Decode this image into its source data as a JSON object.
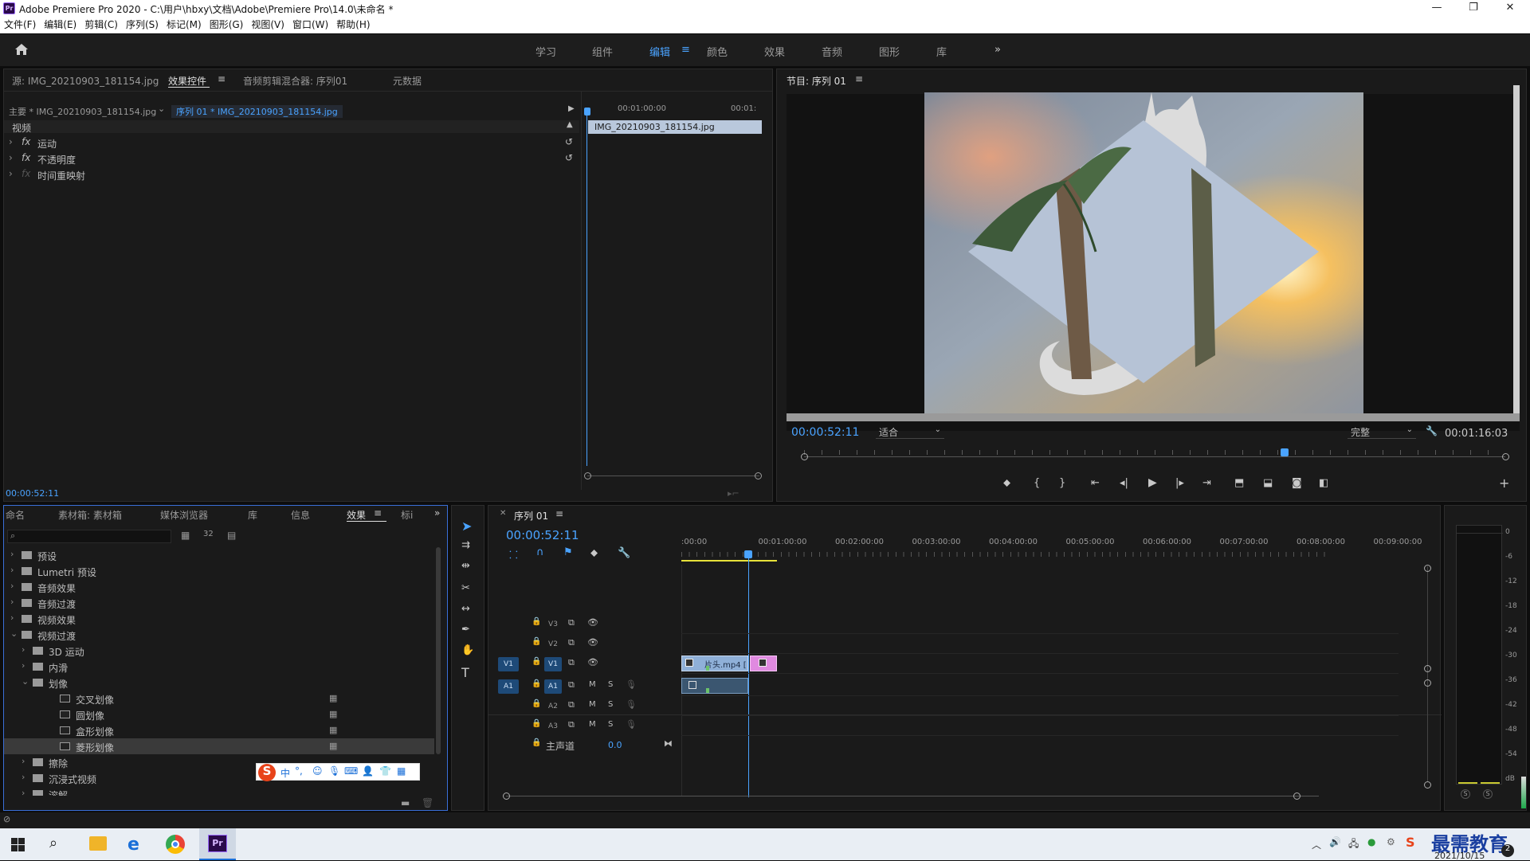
{
  "window": {
    "title": "Adobe Premiere Pro 2020 - C:\\用户\\hbxy\\文档\\Adobe\\Premiere Pro\\14.0\\未命名 *",
    "logo": "Pr",
    "controls": [
      "minimize-icon",
      "restore-icon",
      "close-icon"
    ]
  },
  "menu": [
    "文件(F)",
    "编辑(E)",
    "剪辑(C)",
    "序列(S)",
    "标记(M)",
    "图形(G)",
    "视图(V)",
    "窗口(W)",
    "帮助(H)"
  ],
  "workspaces": [
    "学习",
    "组件",
    "编辑",
    "颜色",
    "效果",
    "音频",
    "图形",
    "库"
  ],
  "active_workspace": "编辑",
  "effect_controls": {
    "tabs": [
      "源: IMG_20210903_181154.jpg",
      "效果控件",
      "音频剪辑混合器: 序列01",
      "元数据"
    ],
    "active_tab": "效果控件",
    "master": "主要 * IMG_20210903_181154.jpg",
    "sequence_clip": "序列 01 * IMG_20210903_181154.jpg",
    "ruler": [
      "00:01:00:00",
      "00:01:"
    ],
    "clip_name": "IMG_20210903_181154.jpg",
    "section": "视频",
    "effects": [
      {
        "fx": "fx",
        "name": "运动"
      },
      {
        "fx": "fx",
        "name": "不透明度"
      },
      {
        "fx": "fx",
        "name": "时间重映射"
      }
    ],
    "timecode": "00:00:52:11"
  },
  "program": {
    "title": "节目: 序列 01",
    "timecode": "00:00:52:11",
    "fit": "适合",
    "quality": "完整",
    "duration": "00:01:16:03",
    "playhead_fraction": 0.685
  },
  "project": {
    "tabs": [
      "命名",
      "素材箱: 素材箱",
      "媒体浏览器",
      "库",
      "信息",
      "效果",
      "标i"
    ],
    "active_tab": "效果",
    "search_placeholder": "",
    "tree": [
      {
        "label": "预设",
        "level": 0,
        "type": "folder-special",
        "open": false
      },
      {
        "label": "Lumetri 预设",
        "level": 0,
        "type": "folder-special",
        "open": false
      },
      {
        "label": "音频效果",
        "level": 0,
        "type": "folder",
        "open": false
      },
      {
        "label": "音频过渡",
        "level": 0,
        "type": "folder",
        "open": false
      },
      {
        "label": "视频效果",
        "level": 0,
        "type": "folder",
        "open": false
      },
      {
        "label": "视频过渡",
        "level": 0,
        "type": "folder",
        "open": true
      },
      {
        "label": "3D 运动",
        "level": 1,
        "type": "folder",
        "open": false
      },
      {
        "label": "内滑",
        "level": 1,
        "type": "folder",
        "open": false
      },
      {
        "label": "划像",
        "level": 1,
        "type": "folder",
        "open": true
      },
      {
        "label": "交叉划像",
        "level": 2,
        "type": "item",
        "badge": true
      },
      {
        "label": "圆划像",
        "level": 2,
        "type": "item",
        "badge": true
      },
      {
        "label": "盒形划像",
        "level": 2,
        "type": "item",
        "badge": true
      },
      {
        "label": "菱形划像",
        "level": 2,
        "type": "item",
        "badge": true,
        "selected": true
      },
      {
        "label": "擦除",
        "level": 1,
        "type": "folder",
        "open": false
      },
      {
        "label": "沉浸式视频",
        "level": 1,
        "type": "folder",
        "open": false
      },
      {
        "label": "溶解",
        "level": 1,
        "type": "folder",
        "open": false
      }
    ]
  },
  "ime": {
    "label": "中",
    "punct": "°,"
  },
  "timeline": {
    "tab": "序列 01",
    "timecode": "00:00:52:11",
    "ruler": [
      ":00:00",
      "00:01:00:00",
      "00:02:00:00",
      "00:03:00:00",
      "00:04:00:00",
      "00:05:00:00",
      "00:06:00:00",
      "00:07:00:00",
      "00:08:00:00",
      "00:09:00:00"
    ],
    "tracks": [
      {
        "name": "V3",
        "kind": "video"
      },
      {
        "name": "V2",
        "kind": "video"
      },
      {
        "name": "V1",
        "kind": "video",
        "source": "V1"
      },
      {
        "name": "A1",
        "kind": "audio",
        "source": "A1"
      },
      {
        "name": "A2",
        "kind": "audio"
      },
      {
        "name": "A3",
        "kind": "audio"
      }
    ],
    "mix_label": "主声道",
    "mix_value": "0.0",
    "clip_v1": "片头.mp4 [",
    "mute": "M",
    "solo": "S"
  },
  "meter": {
    "ticks": [
      "0",
      "-6",
      "-12",
      "-18",
      "-24",
      "-30",
      "-36",
      "-42",
      "-48",
      "-54",
      "dB"
    ],
    "buttons": [
      "S",
      "S"
    ]
  },
  "taskbar": {
    "date": "2021/10/15",
    "watermark": "最需教育",
    "badge": "2"
  },
  "colors": {
    "accent": "#4aa3ff",
    "panel": "#1a1a1a",
    "selected_panel_border": "#3a6fd8",
    "clip_video": "#8fb0d8",
    "clip_pink": "#e08ae0"
  }
}
